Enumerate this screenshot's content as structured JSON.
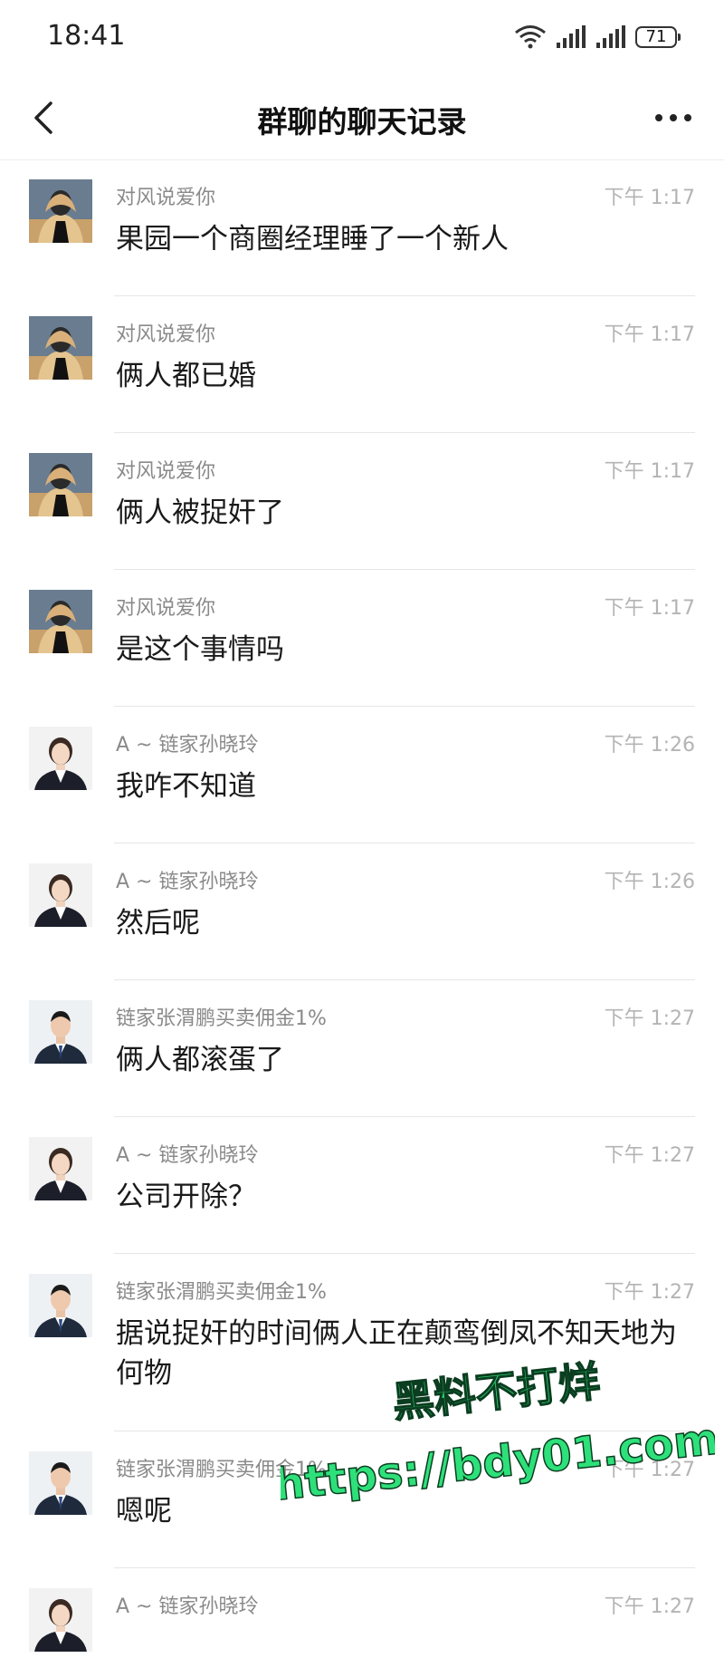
{
  "status": {
    "time": "18:41",
    "battery": "71"
  },
  "nav": {
    "title": "群聊的聊天记录"
  },
  "messages": [
    {
      "sender": "对风说爱你",
      "time": "下午 1:17",
      "text": "果园一个商圈经理睡了一个新人",
      "avatar": "man-covering-face"
    },
    {
      "sender": "对风说爱你",
      "time": "下午 1:17",
      "text": "俩人都已婚",
      "avatar": "man-covering-face"
    },
    {
      "sender": "对风说爱你",
      "time": "下午 1:17",
      "text": "俩人被捉奸了",
      "avatar": "man-covering-face"
    },
    {
      "sender": "对风说爱你",
      "time": "下午 1:17",
      "text": "是这个事情吗",
      "avatar": "man-covering-face"
    },
    {
      "sender": "A ~ 链家孙晓玲",
      "time": "下午 1:26",
      "text": "我咋不知道",
      "avatar": "woman-suit"
    },
    {
      "sender": "A ~ 链家孙晓玲",
      "time": "下午 1:26",
      "text": "然后呢",
      "avatar": "woman-suit"
    },
    {
      "sender": "链家张渭鹏买卖佣金1%",
      "time": "下午 1:27",
      "text": "俩人都滚蛋了",
      "avatar": "man-suit"
    },
    {
      "sender": "A ~ 链家孙晓玲",
      "time": "下午 1:27",
      "text": "公司开除？",
      "avatar": "woman-suit"
    },
    {
      "sender": "链家张渭鹏买卖佣金1%",
      "time": "下午 1:27",
      "text": "据说捉奸的时间俩人正在颠鸾倒凤不知天地为何物",
      "avatar": "man-suit"
    },
    {
      "sender": "链家张渭鹏买卖佣金1%",
      "time": "下午 1:27",
      "text": "嗯呢",
      "avatar": "man-suit"
    },
    {
      "sender": "A ~ 链家孙晓玲",
      "time": "下午 1:27",
      "text": "",
      "avatar": "woman-suit"
    }
  ],
  "watermark": {
    "line1": "黑料不打烊",
    "line2": "https://bdy01.com",
    "color": "#2ee07a"
  }
}
